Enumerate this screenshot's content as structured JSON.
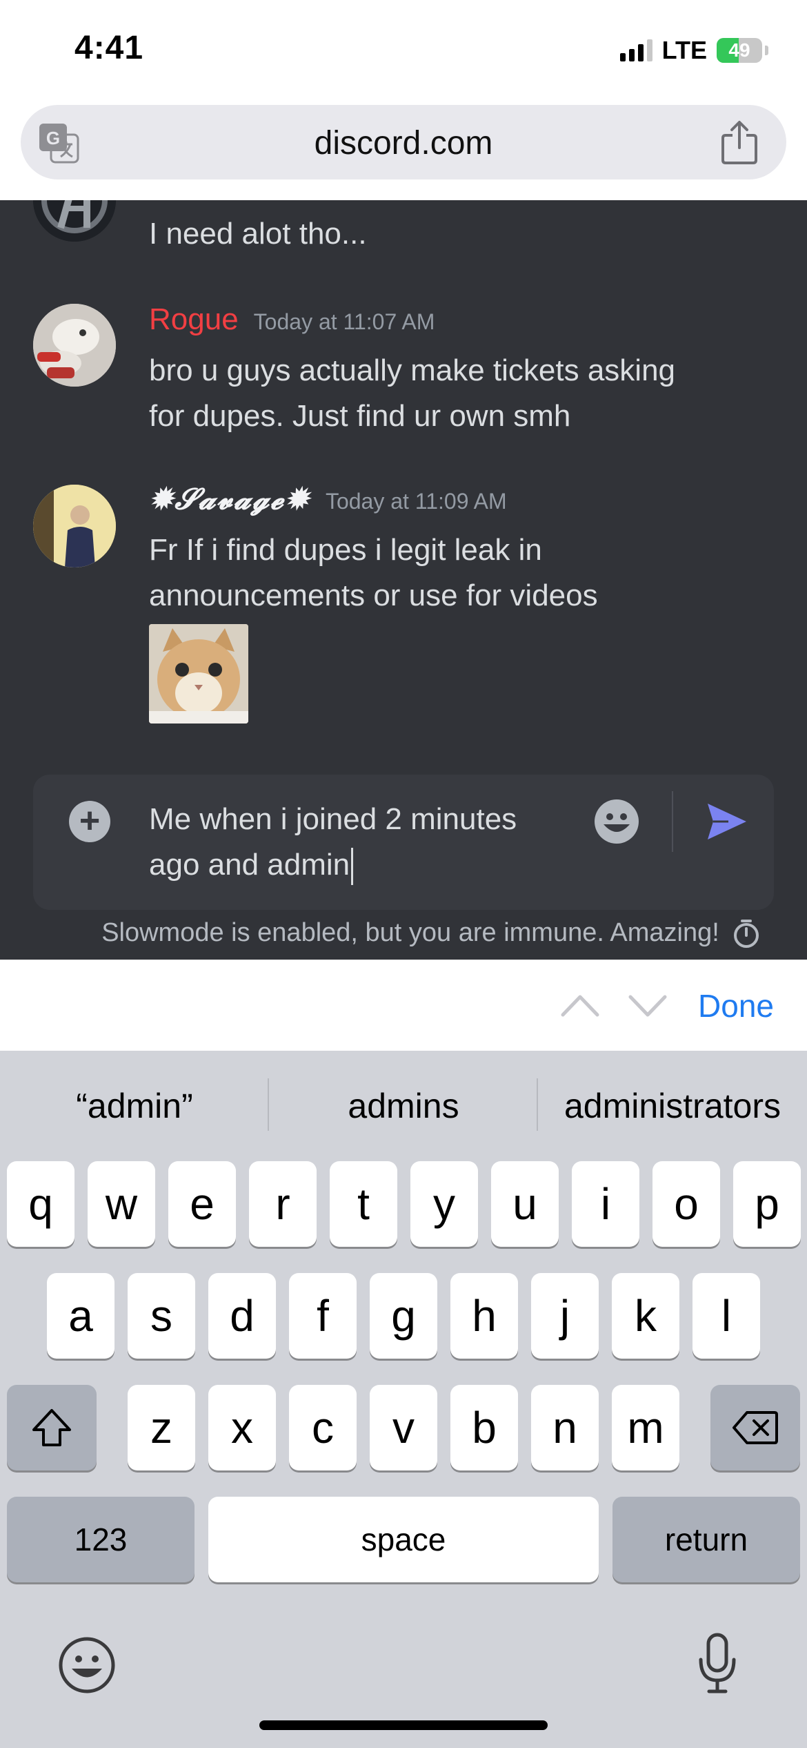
{
  "status_bar": {
    "time": "4:41",
    "network": "LTE",
    "battery": "49",
    "battery_level": 0.49
  },
  "browser": {
    "url": "discord.com",
    "translate_icon": "translate-icon",
    "share_icon": "share-icon"
  },
  "chat": {
    "partial_message": {
      "text": "I need alot tho..."
    },
    "messages": [
      {
        "username": "Rogue",
        "timestamp": "Today at 11:07 AM",
        "lines": [
          "bro u guys actually make tickets asking",
          "for dupes. Just find ur own smh"
        ]
      },
      {
        "username": "✹𝓢𝓪𝓿𝓪𝓰𝓮✹",
        "timestamp": "Today at 11:09 AM",
        "lines": [
          "Fr If i find dupes i legit leak in",
          "announcements or use for videos"
        ]
      }
    ],
    "composer": {
      "line1": "Me when i joined 2 minutes",
      "line2": "ago and admin"
    },
    "slowmode_text": "Slowmode is enabled, but you are immune. Amazing!",
    "colors": {
      "background": "#313338",
      "rogue": "#f23f43",
      "send": "#5865f2"
    }
  },
  "keyboard_toolbar": {
    "done": "Done"
  },
  "keyboard": {
    "suggestions": [
      "“admin”",
      "admins",
      "administrators"
    ],
    "row1": [
      "q",
      "w",
      "e",
      "r",
      "t",
      "y",
      "u",
      "i",
      "o",
      "p"
    ],
    "row2": [
      "a",
      "s",
      "d",
      "f",
      "g",
      "h",
      "j",
      "k",
      "l"
    ],
    "row3": [
      "z",
      "x",
      "c",
      "v",
      "b",
      "n",
      "m"
    ],
    "numbers_key": "123",
    "space_key": "space",
    "return_key": "return"
  }
}
